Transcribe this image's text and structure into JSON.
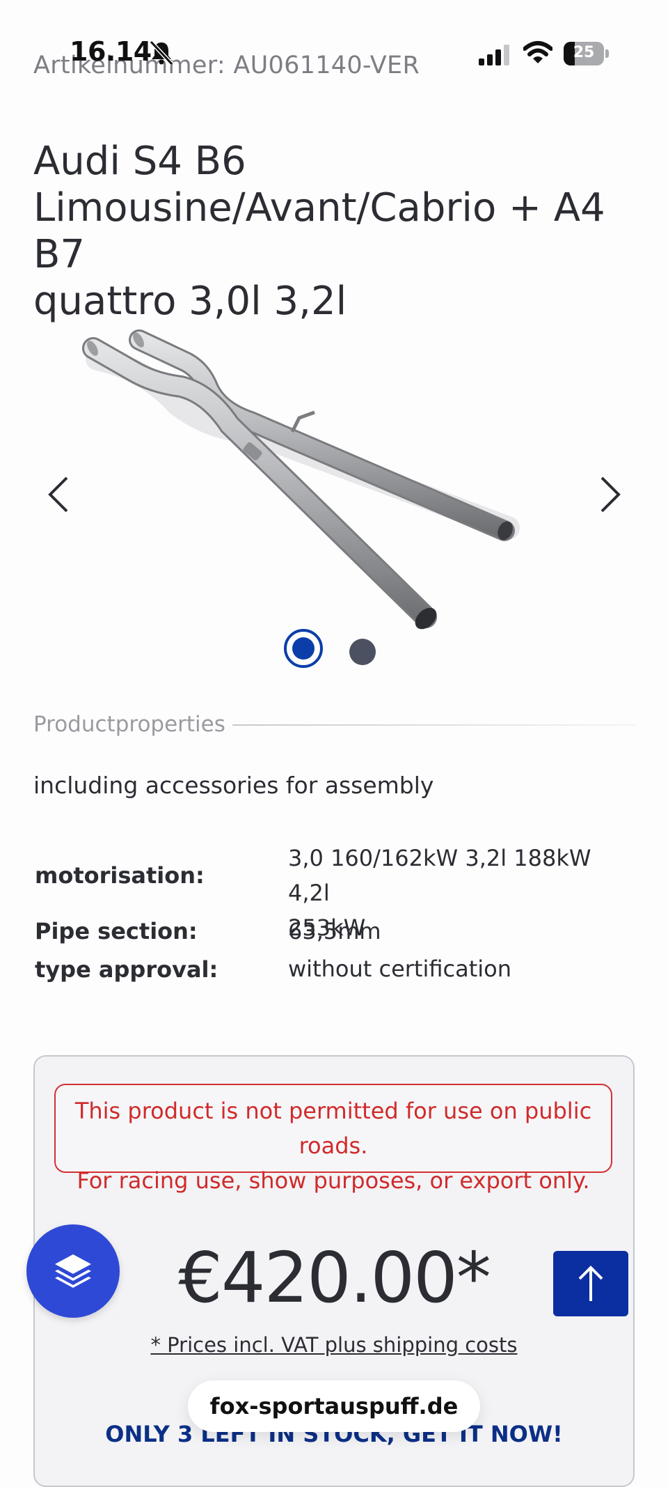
{
  "status_bar": {
    "time": "16.14",
    "battery": "25"
  },
  "product": {
    "sku": "Artikelnummer: AU061140-VER",
    "title_lines": [
      "Audi S4 B6",
      "Limousine/Avant/Cabrio + A4 B7",
      "quattro 3,0l 3,2l"
    ]
  },
  "gallery": {
    "prev_icon": "chevron-left-icon",
    "next_icon": "chevron-right-icon",
    "active_index": 0,
    "total_images": 2
  },
  "properties": {
    "header": "Productproperties",
    "description": "including accessories for assembly",
    "specs": [
      {
        "label": "motorisation:",
        "value_lines": [
          "3,0 160/162kW 3,2l 188kW 4,2l",
          "253kW"
        ]
      },
      {
        "label": "Pipe section:",
        "value_lines": [
          "63,5mm"
        ]
      },
      {
        "label": "type approval:",
        "value_lines": [
          "without certification"
        ]
      }
    ]
  },
  "buy_box": {
    "warning_lines": [
      "This product is not permitted for use on public roads.",
      "For racing use, show purposes, or export only."
    ],
    "price": "€420.00*",
    "price_note": "* Prices incl. VAT plus shipping costs",
    "stock": "ONLY 3 LEFT IN STOCK, GET IT NOW!"
  },
  "floating": {
    "layers_icon": "layers-icon",
    "scroll_top_icon": "arrow-up-icon"
  },
  "browser": {
    "url": "fox-sportauspuff.de"
  },
  "colors": {
    "accent_blue": "#0b2fa0",
    "fab_blue": "#2e49d6",
    "warning_red": "#d02a2a",
    "text": "#2b2d33"
  }
}
